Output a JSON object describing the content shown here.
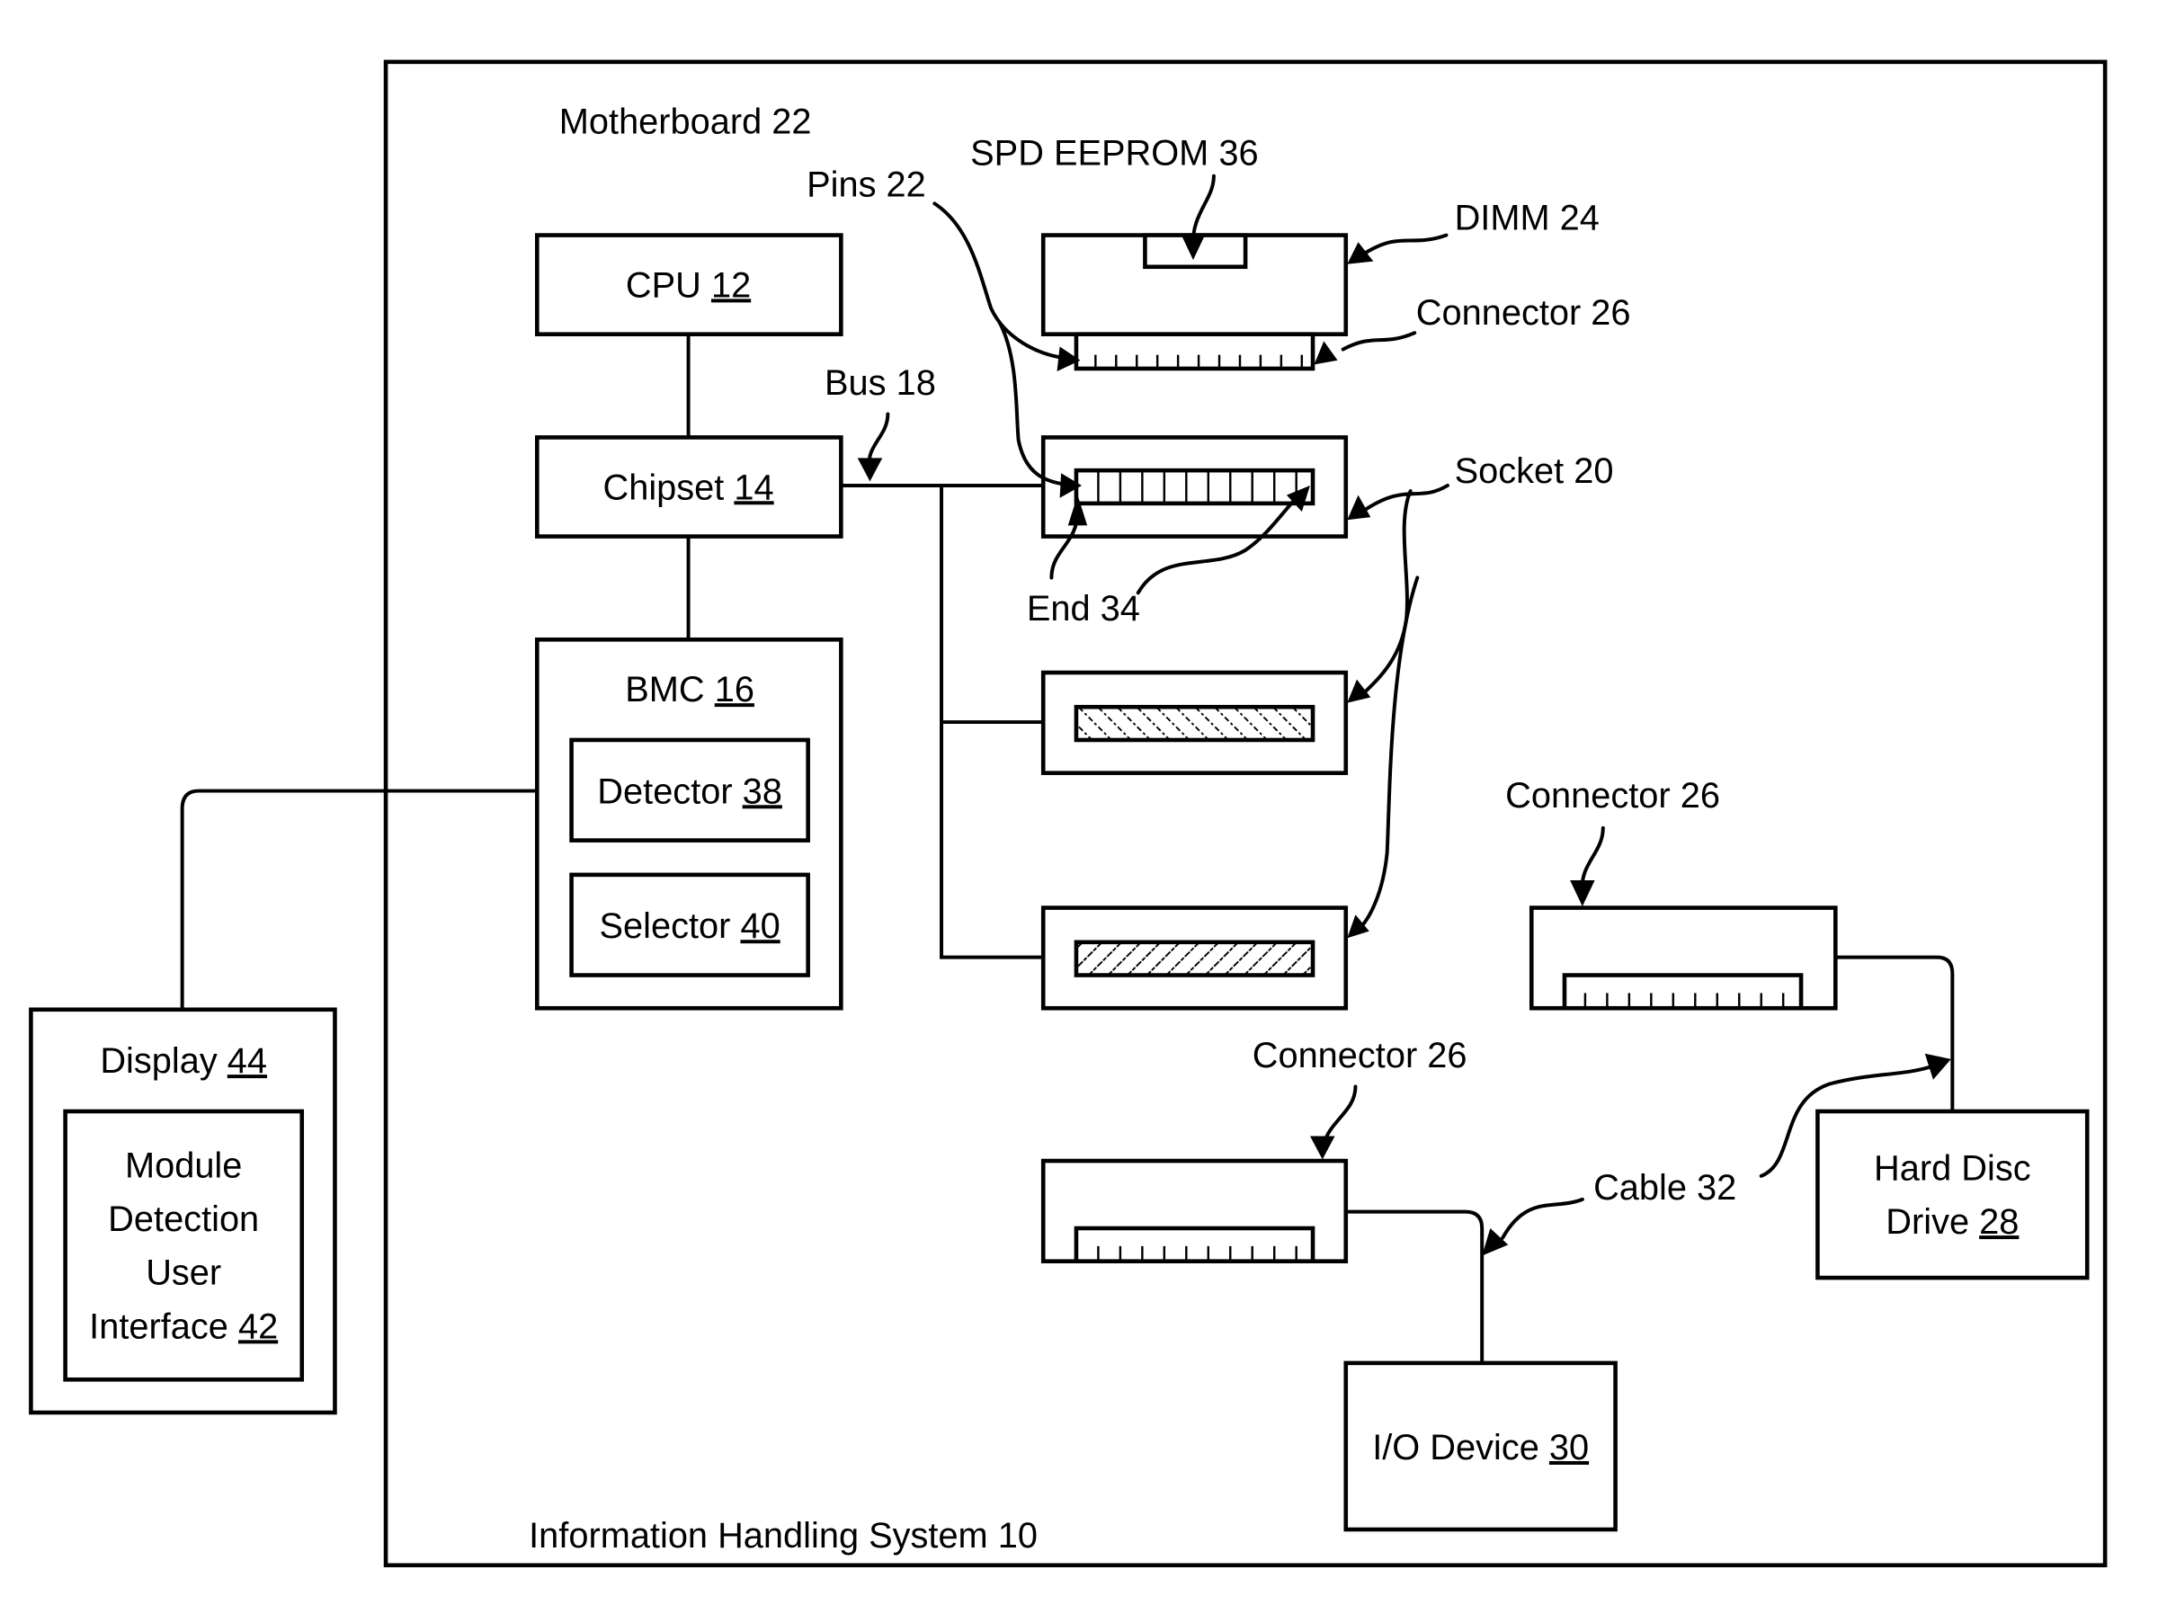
{
  "diagram": {
    "system_label": "Information Handling System 10",
    "motherboard_label": "Motherboard 22",
    "components": {
      "cpu": {
        "name": "CPU",
        "ref": "12"
      },
      "chipset": {
        "name": "Chipset",
        "ref": "14"
      },
      "bmc": {
        "name": "BMC",
        "ref": "16"
      },
      "detector": {
        "name": "Detector",
        "ref": "38"
      },
      "selector": {
        "name": "Selector",
        "ref": "40"
      },
      "display": {
        "name": "Display",
        "ref": "44"
      },
      "ui": {
        "lines": [
          "Module",
          "Detection",
          "User"
        ],
        "last_line": "Interface",
        "ref": "42"
      },
      "hdd": {
        "line1": "Hard Disc",
        "line2": "Drive",
        "ref": "28"
      },
      "io": {
        "name": "I/O Device",
        "ref": "30"
      }
    },
    "callouts": {
      "spd": "SPD EEPROM 36",
      "pins": "Pins 22",
      "dimm": "DIMM 24",
      "connector_dimm": "Connector 26",
      "bus": "Bus 18",
      "socket": "Socket 20",
      "end": "End 34",
      "connector_hdd": "Connector 26",
      "connector_io": "Connector 26",
      "cable": "Cable 32"
    }
  }
}
